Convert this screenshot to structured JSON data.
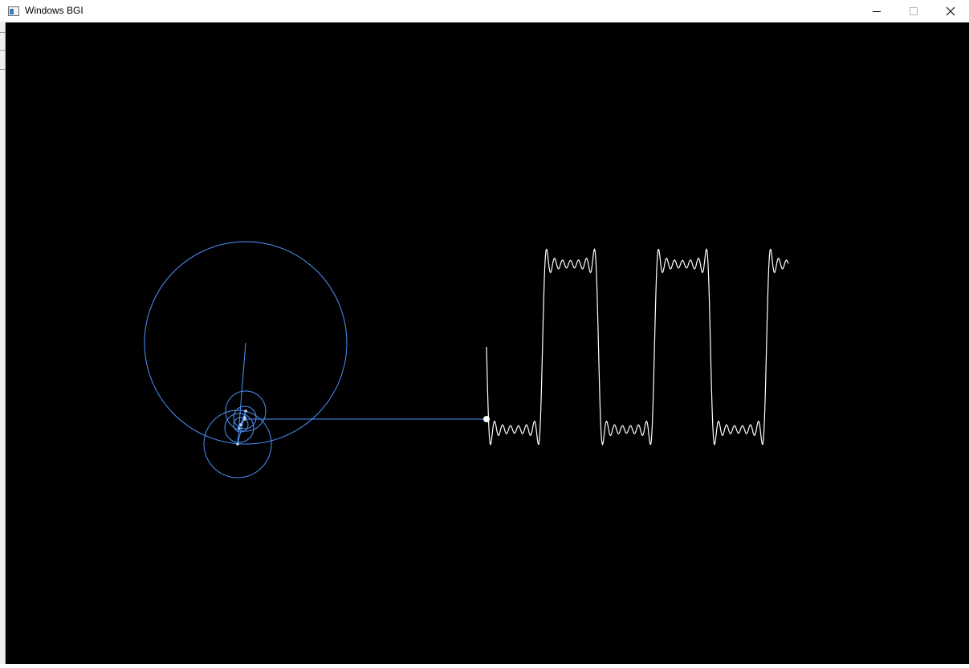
{
  "window": {
    "title": "Windows BGI",
    "controls": {
      "minimize": "minimize-icon",
      "maximize": "maximize-icon",
      "close": "close-icon"
    }
  },
  "colors": {
    "canvas_background": "#000000",
    "epicycle_color": "#4d94ff",
    "wave_color": "#ffffff"
  },
  "drawing": {
    "epicycles": {
      "count": 6
    },
    "wave": {
      "shape": "square wave (Fourier approximation)",
      "plateaus": [
        "high",
        "low",
        "high",
        "low",
        "high"
      ]
    }
  }
}
